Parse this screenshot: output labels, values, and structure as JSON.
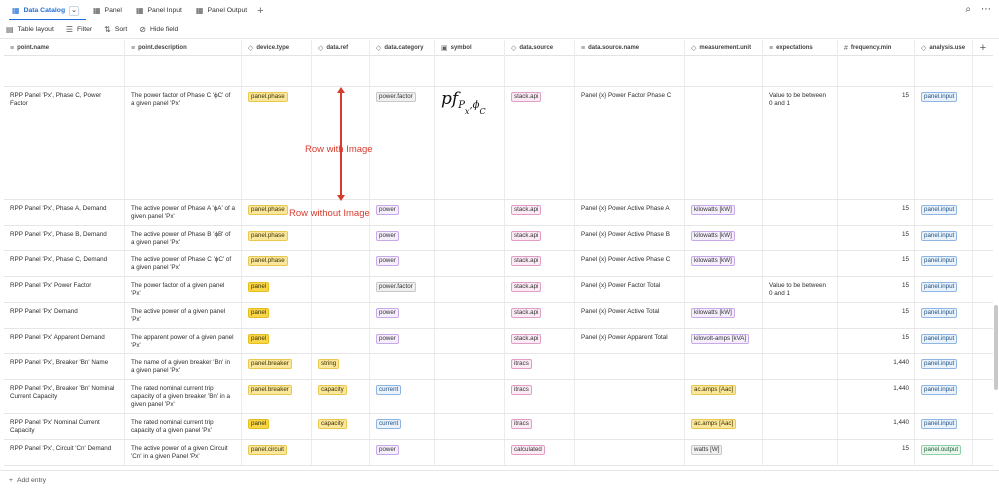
{
  "tabs": [
    {
      "label": "Data Catalog",
      "icon": "table-icon",
      "active": true
    },
    {
      "label": "Panel",
      "icon": "table-icon",
      "active": false
    },
    {
      "label": "Panel Input",
      "icon": "table-icon",
      "active": false
    },
    {
      "label": "Panel Output",
      "icon": "table-icon",
      "active": false
    }
  ],
  "toolbar": {
    "table_layout": "Table layout",
    "filter": "Filter",
    "sort": "Sort",
    "hide_field": "Hide field"
  },
  "columns": [
    {
      "label": "point.name",
      "icon": "text-icon"
    },
    {
      "label": "point.description",
      "icon": "text-icon"
    },
    {
      "label": "device.type",
      "icon": "tag-icon"
    },
    {
      "label": "data.ref",
      "icon": "tag-icon"
    },
    {
      "label": "data.category",
      "icon": "tag-icon"
    },
    {
      "label": "symbol",
      "icon": "image-icon"
    },
    {
      "label": "data.source",
      "icon": "tag-icon"
    },
    {
      "label": "data.source.name",
      "icon": "text-icon"
    },
    {
      "label": "measurement.unit",
      "icon": "tag-icon"
    },
    {
      "label": "expectations",
      "icon": "text-icon"
    },
    {
      "label": "frequency.min",
      "icon": "number-icon"
    },
    {
      "label": "analysis.use",
      "icon": "tag-icon"
    }
  ],
  "rows": [
    {
      "name": "",
      "description": "",
      "device_type": "",
      "data_ref": "",
      "data_category": "",
      "data_source": "",
      "source_name": "",
      "unit": "",
      "expectations": "",
      "frequency": "",
      "analysis_use": ""
    },
    {
      "name": "RPP Panel 'Px', Phase C, Power Factor",
      "description": "The power factor of Phase C 'ϕC' of a given panel 'Px'",
      "device_type": "panel.phase",
      "data_ref": "",
      "data_category": "power.factor",
      "data_source": "stack.api",
      "source_name": "Panel {x} Power Factor Phase C",
      "unit": "",
      "expectations": "Value to be between 0 and 1",
      "frequency": "15",
      "analysis_use": "panel.input"
    },
    {
      "name": "RPP Panel 'Px', Phase A, Demand",
      "description": "The active power of Phase A 'ϕA' of a given panel 'Px'",
      "device_type": "panel.phase",
      "data_ref": "",
      "data_category": "power",
      "data_source": "stack.api",
      "source_name": "Panel {x} Power Active Phase A",
      "unit": "kilowatts [kW]",
      "expectations": "",
      "frequency": "15",
      "analysis_use": "panel.input"
    },
    {
      "name": "RPP Panel 'Px', Phase B, Demand",
      "description": "The active power of Phase B 'ϕB' of a given panel 'Px'",
      "device_type": "panel.phase",
      "data_ref": "",
      "data_category": "power",
      "data_source": "stack.api",
      "source_name": "Panel {x} Power Active Phase B",
      "unit": "kilowatts [kW]",
      "expectations": "",
      "frequency": "15",
      "analysis_use": "panel.input"
    },
    {
      "name": "RPP Panel 'Px', Phase C, Demand",
      "description": "The active power of Phase C 'ϕC' of a given panel 'Px'",
      "device_type": "panel.phase",
      "data_ref": "",
      "data_category": "power",
      "data_source": "stack.api",
      "source_name": "Panel {x} Power Active Phase C",
      "unit": "kilowatts [kW]",
      "expectations": "",
      "frequency": "15",
      "analysis_use": "panel.input"
    },
    {
      "name": "RPP Panel 'Px' Power Factor",
      "description": "The power factor of a given panel 'Px'",
      "device_type": "panel",
      "data_ref": "",
      "data_category": "power.factor",
      "data_source": "stack.api",
      "source_name": "Panel {x} Power Factor Total",
      "unit": "",
      "expectations": "Value to be between 0 and 1",
      "frequency": "15",
      "analysis_use": "panel.input"
    },
    {
      "name": "RPP Panel 'Px' Demand",
      "description": "The active power of a given panel 'Px'",
      "device_type": "panel",
      "data_ref": "",
      "data_category": "power",
      "data_source": "stack.api",
      "source_name": "Panel {x} Power Active Total",
      "unit": "kilowatts [kW]",
      "expectations": "",
      "frequency": "15",
      "analysis_use": "panel.input"
    },
    {
      "name": "RPP Panel 'Px' Apparent Demand",
      "description": "The apparent power of a given panel 'Px'",
      "device_type": "panel",
      "data_ref": "",
      "data_category": "power",
      "data_source": "stack.api",
      "source_name": "Panel {x} Power Apparent Total",
      "unit": "kilovolt-amps [kVA]",
      "expectations": "",
      "frequency": "15",
      "analysis_use": "panel.input"
    },
    {
      "name": "RPP Panel 'Px', Breaker 'Bn' Name",
      "description": "The name of a given breaker 'Bn' in a given panel 'Px'",
      "device_type": "panel.breaker",
      "data_ref": "string",
      "data_category": "",
      "data_source": "itracs",
      "source_name": "",
      "unit": "",
      "expectations": "",
      "frequency": "1,440",
      "analysis_use": "panel.input"
    },
    {
      "name": "RPP Panel 'Px', Breaker 'Bn' Nominal Current Capacity",
      "description": "The rated nominal current trip capacity of a given breaker 'Bn' in a given panel 'Px'",
      "device_type": "panel.breaker",
      "data_ref": "capacity",
      "data_category": "current",
      "data_source": "itracs",
      "source_name": "",
      "unit": "ac.amps [Aac]",
      "expectations": "",
      "frequency": "1,440",
      "analysis_use": "panel.input"
    },
    {
      "name": "RPP Panel 'Px' Nominal Current Capacity",
      "description": "The rated nominal current trip capacity of a given panel 'Px'",
      "device_type": "panel",
      "data_ref": "capacity",
      "data_category": "current",
      "data_source": "itracs",
      "source_name": "",
      "unit": "ac.amps [Aac]",
      "expectations": "",
      "frequency": "1,440",
      "analysis_use": "panel.input"
    },
    {
      "name": "RPP Panel 'Px', Circuit 'Cn' Demand",
      "description": "The active power of a given Circuit 'Cn' in a given Panel 'Px'",
      "device_type": "panel.circuit",
      "data_ref": "",
      "data_category": "power",
      "data_source": "calculated",
      "source_name": "",
      "unit": "watts [W]",
      "expectations": "",
      "frequency": "15",
      "analysis_use": "panel.output"
    }
  ],
  "symbol": {
    "base": "pf",
    "sub": "P",
    "sub_sub": "x",
    "sep": ",",
    "phi": "ϕ",
    "phi_sub": "C"
  },
  "annotations": {
    "with_image": "Row with Image",
    "without_image": "Row without Image"
  },
  "footer": {
    "add_entry": "Add entry"
  },
  "colors": {
    "accent": "#1f6fd6",
    "annotation": "#d93a2e"
  }
}
